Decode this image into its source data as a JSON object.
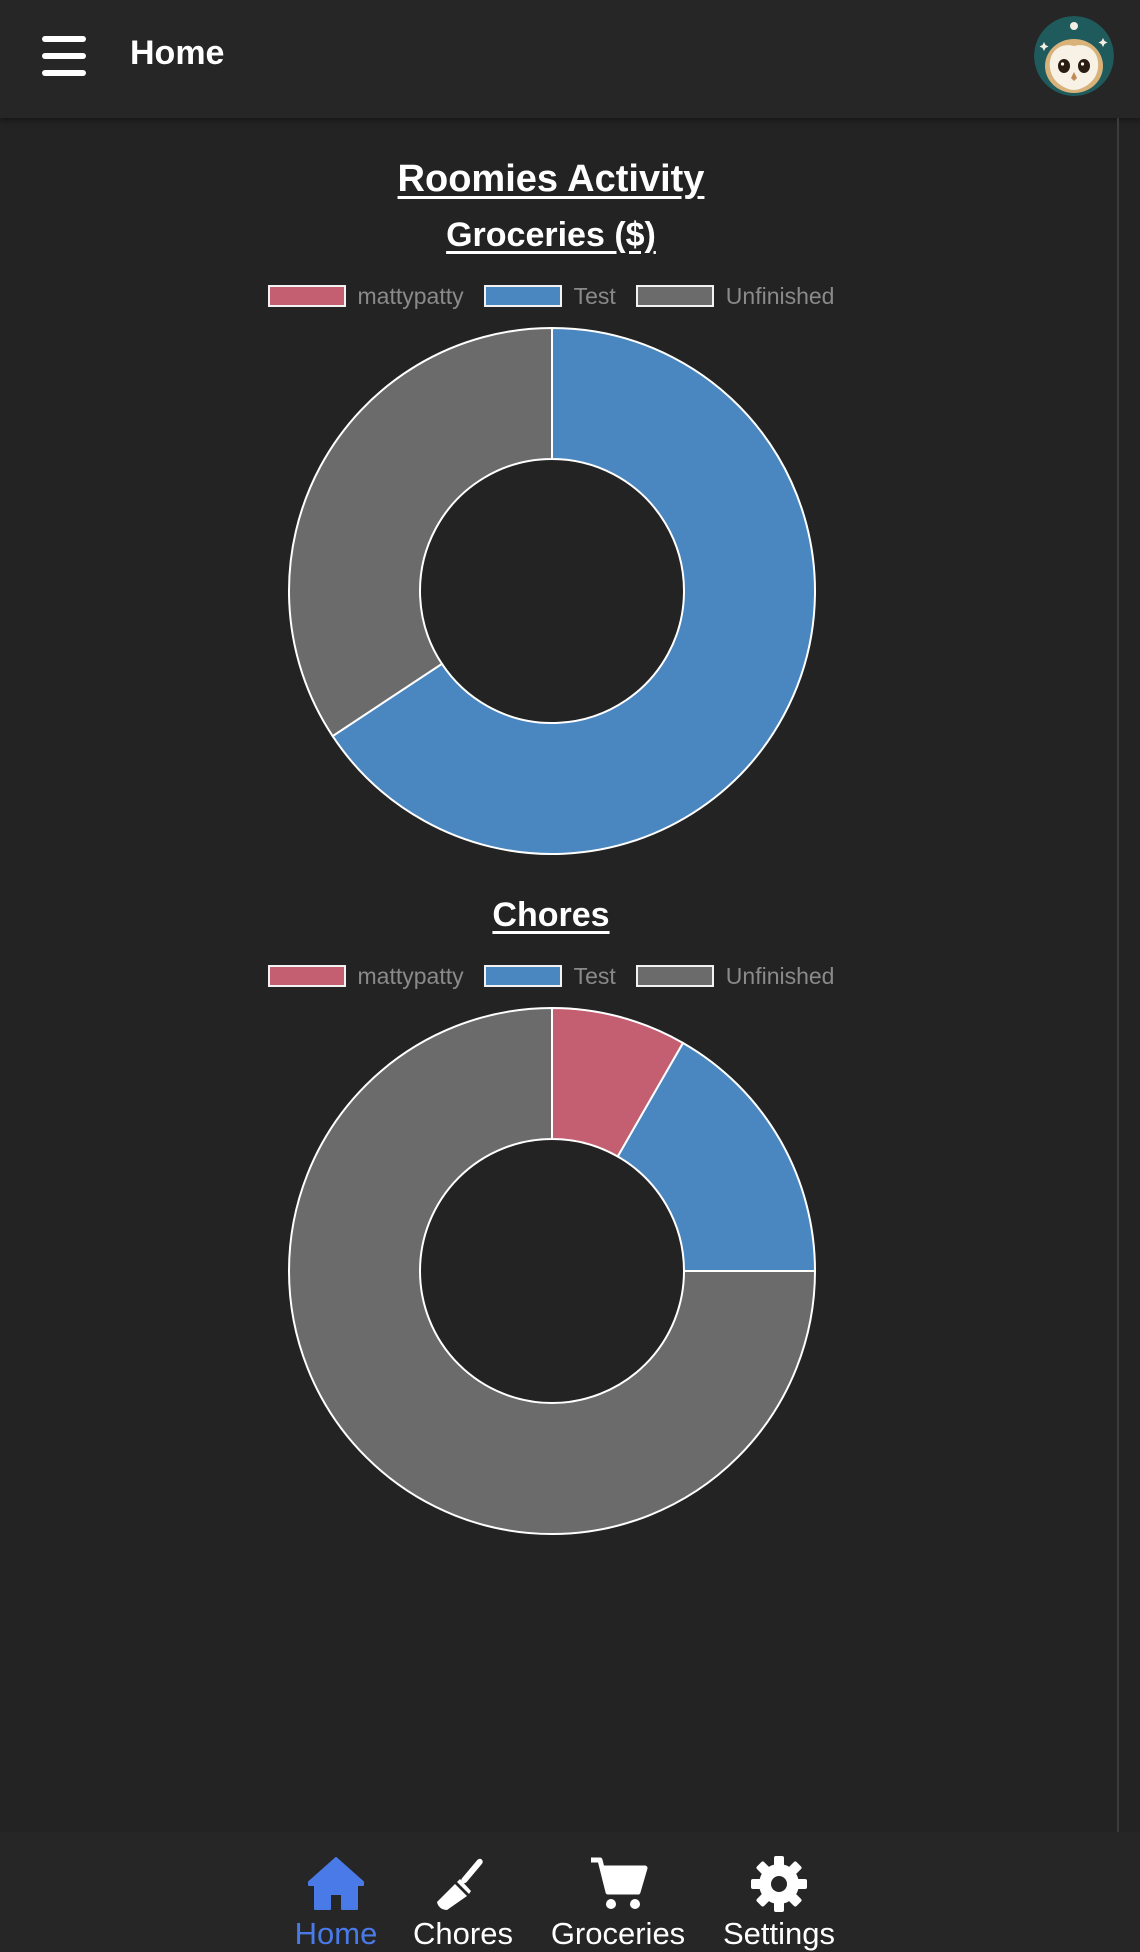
{
  "header": {
    "title": "Home",
    "avatar_icon": "owl-avatar-icon"
  },
  "colors": {
    "accent": "#4a7ae8",
    "mattypatty": "#c45f72",
    "test": "#4a86c0",
    "unfinished": "#6b6b6b"
  },
  "main": {
    "title": "Roomies Activity"
  },
  "charts": [
    {
      "title": "Groceries ($)",
      "legend": [
        "mattypatty",
        "Test",
        "Unfinished"
      ]
    },
    {
      "title": "Chores",
      "legend": [
        "mattypatty",
        "Test",
        "Unfinished"
      ]
    }
  ],
  "chart_data": [
    {
      "type": "pie",
      "title": "Groceries ($)",
      "categories": [
        "mattypatty",
        "Test",
        "Unfinished"
      ],
      "values": [
        0,
        65.7,
        34.3
      ],
      "colors": [
        "#c45f72",
        "#4a86c0",
        "#6b6b6b"
      ],
      "legend": "top"
    },
    {
      "type": "pie",
      "title": "Chores",
      "categories": [
        "mattypatty",
        "Test",
        "Unfinished"
      ],
      "values": [
        8.3,
        16.7,
        75
      ],
      "colors": [
        "#c45f72",
        "#4a86c0",
        "#6b6b6b"
      ],
      "legend": "top"
    }
  ],
  "nav": {
    "items": [
      {
        "label": "Home",
        "icon": "home-icon",
        "active": true
      },
      {
        "label": "Chores",
        "icon": "broom-icon",
        "active": false
      },
      {
        "label": "Groceries",
        "icon": "cart-icon",
        "active": false
      },
      {
        "label": "Settings",
        "icon": "gear-icon",
        "active": false
      }
    ]
  }
}
